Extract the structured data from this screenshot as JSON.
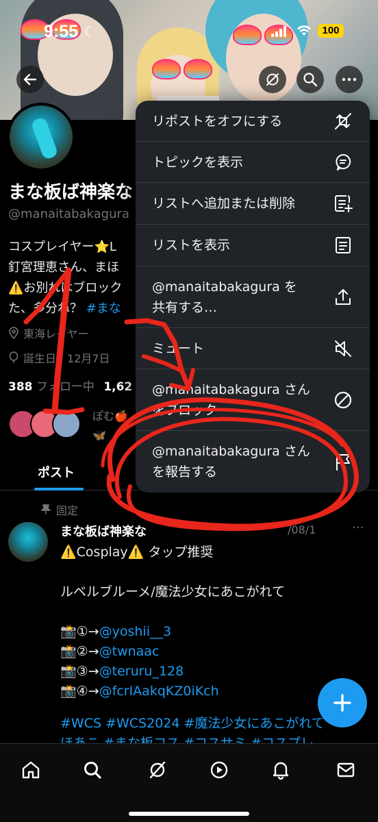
{
  "status_bar": {
    "time": "9:55",
    "battery": "100"
  },
  "profile": {
    "name": "まな板ば神楽な",
    "handle": "@manaitabakagura",
    "bio_lines": [
      "コスプレイヤー⭐L",
      "釘宮理恵さん、まほ",
      "⚠️お別れはブロック",
      "た、多分ね？ "
    ],
    "bio_link": "#まな",
    "location": "東海レイヤー",
    "birthday": "誕生日　12月7日",
    "following_count": "388",
    "following_label": "フォロー中",
    "followers_count": "1,62",
    "followed_by": "ぽむ🍎",
    "followed_by_line2": "🦋"
  },
  "tabs": [
    {
      "label": "ポスト"
    }
  ],
  "post": {
    "pinned_label": "固定",
    "author": "まな板ば神楽な",
    "date": "/08/1",
    "more": "···",
    "lines": [
      "⚠️Cosplay⚠️ タップ推奨",
      "",
      "ルベルブルーメ/魔法少女にあこがれて",
      ""
    ],
    "credits": [
      {
        "prefix": "📸①→",
        "link": "@yoshii__3"
      },
      {
        "prefix": "📸②→",
        "link": "@twnaac"
      },
      {
        "prefix": "📸③→",
        "link": "@teruru_128"
      },
      {
        "prefix": "📸④→",
        "link": "@fcrIAakqKZ0iKch"
      }
    ],
    "tags_line1": "#WCS #WCS2024 #魔法少女にあこがれて",
    "tags_line2": "ほあこ #まな板コス #コスサミ #コスプレ"
  },
  "menu": {
    "items": [
      {
        "label": "リポストをオフにする",
        "icon": "repost-off-icon"
      },
      {
        "label": "トピックを表示",
        "icon": "topic-icon"
      },
      {
        "label": "リストへ追加または削除",
        "icon": "list-add-icon"
      },
      {
        "label": "リストを表示",
        "icon": "list-icon"
      },
      {
        "label": "@manaitabakagura を",
        "label2": "共有する…",
        "icon": "share-icon"
      },
      {
        "label": "ミュート",
        "icon": "mute-icon"
      },
      {
        "label": "@manaitabakagura さん",
        "label2": "をブロック",
        "icon": "block-icon"
      },
      {
        "label": "@manaitabakagura さん",
        "label2": "を報告する",
        "icon": "report-flag-icon"
      }
    ]
  },
  "annotation": {
    "text": "1",
    "color": "#e8261c"
  },
  "colors": {
    "accent": "#1d9bf0",
    "menu_bg": "#202327",
    "annotation": "#e8261c"
  }
}
